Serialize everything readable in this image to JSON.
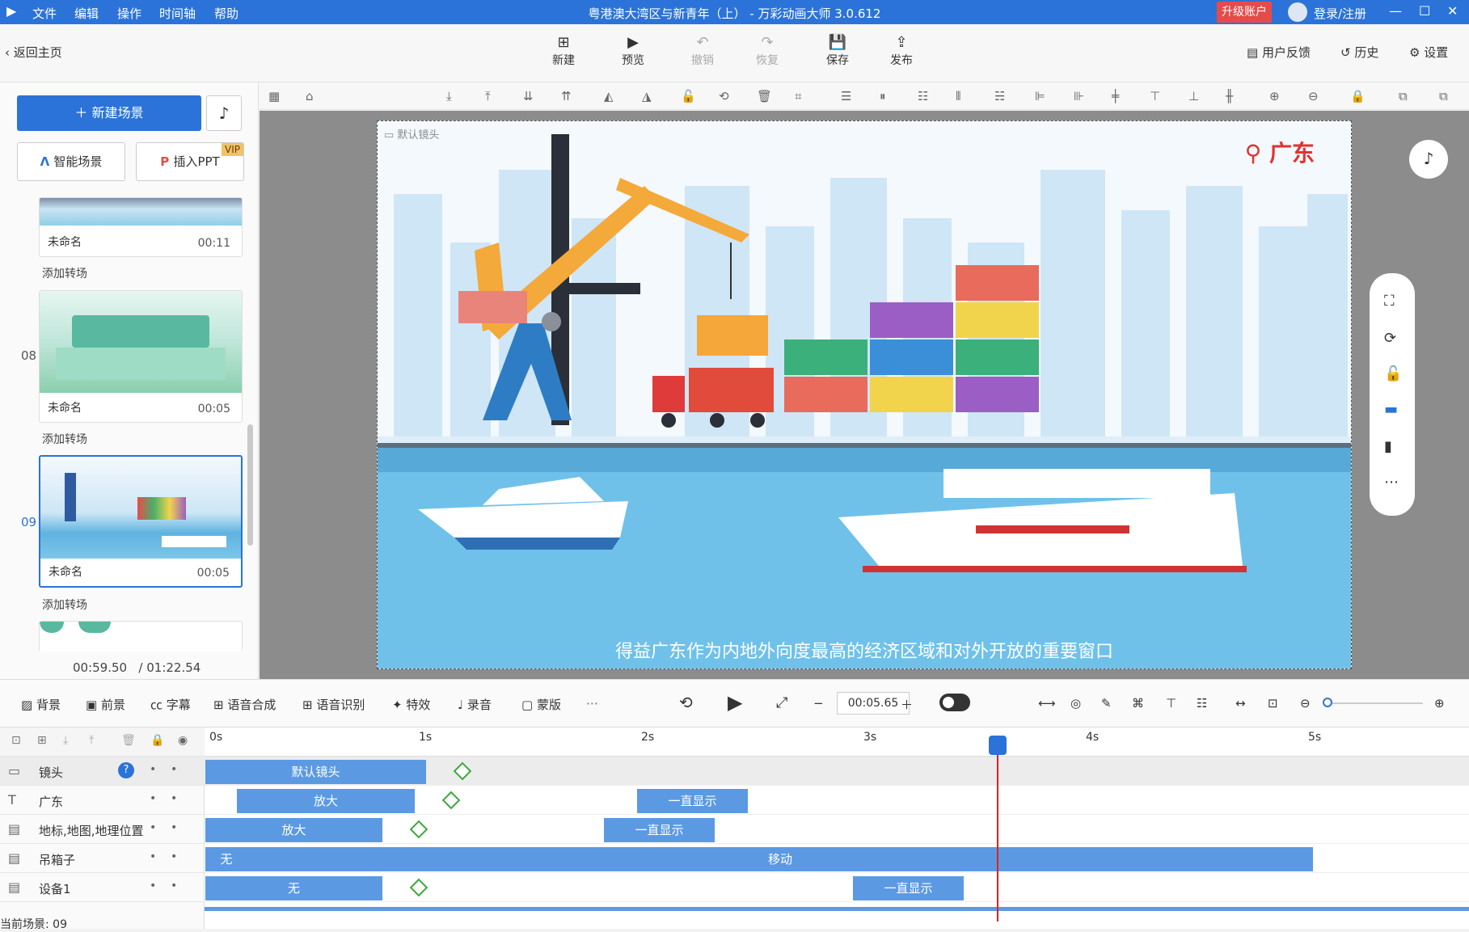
{
  "titlebar": {
    "menus": [
      "文件",
      "编辑",
      "操作",
      "时间轴",
      "帮助"
    ],
    "title": "粤港澳大湾区与新青年（上） - 万彩动画大师 3.0.612",
    "upgrade": "升级账户",
    "login": "登录/注册"
  },
  "toolbar": {
    "back": "返回主页",
    "buttons": [
      "新建",
      "预览",
      "撤销",
      "恢复",
      "保存",
      "发布"
    ],
    "right": [
      "用户反馈",
      "历史",
      "设置"
    ]
  },
  "left": {
    "new_scene": "新建场景",
    "smart_scene": "智能场景",
    "insert_ppt": "插入PPT",
    "vip": "VIP",
    "scenes": [
      {
        "num": "",
        "name": "未命名",
        "time": "00:11"
      },
      {
        "num": "08",
        "name": "未命名",
        "time": "00:05"
      },
      {
        "num": "09",
        "name": "未命名",
        "time": "00:05"
      }
    ],
    "transition": "添加转场",
    "time_current": "00:59.50",
    "time_total": "/ 01:22.54"
  },
  "stage": {
    "lens_label": "默认镜头",
    "location": "广东",
    "subtitle": "得益广东作为内地外向度最高的经济区域和对外开放的重要窗口"
  },
  "bottom": {
    "tools": [
      "背景",
      "前景",
      "字幕",
      "语音合成",
      "语音识别",
      "特效",
      "录音",
      "蒙版"
    ],
    "timecode": "00:05.65"
  },
  "timeline": {
    "ticks": [
      "0s",
      "1s",
      "2s",
      "3s",
      "4s",
      "5s"
    ],
    "tracks": [
      {
        "label": "镜头",
        "clips": [
          {
            "text": "默认镜头"
          }
        ]
      },
      {
        "label": "广东",
        "clips": [
          {
            "text": "放大"
          },
          {
            "text": "一直显示"
          }
        ]
      },
      {
        "label": "地标,地图,地理位置",
        "clips": [
          {
            "text": "放大"
          },
          {
            "text": "一直显示"
          }
        ]
      },
      {
        "label": "吊箱子",
        "clips": [
          {
            "text": "无"
          },
          {
            "text": "移动"
          }
        ]
      },
      {
        "label": "设备1",
        "clips": [
          {
            "text": "无"
          },
          {
            "text": "一直显示"
          }
        ]
      }
    ],
    "current_scene": "当前场景: 09"
  },
  "colors": {
    "accent": "#2b73d8",
    "danger": "#e54b4b",
    "clip": "#5b9ae3"
  }
}
